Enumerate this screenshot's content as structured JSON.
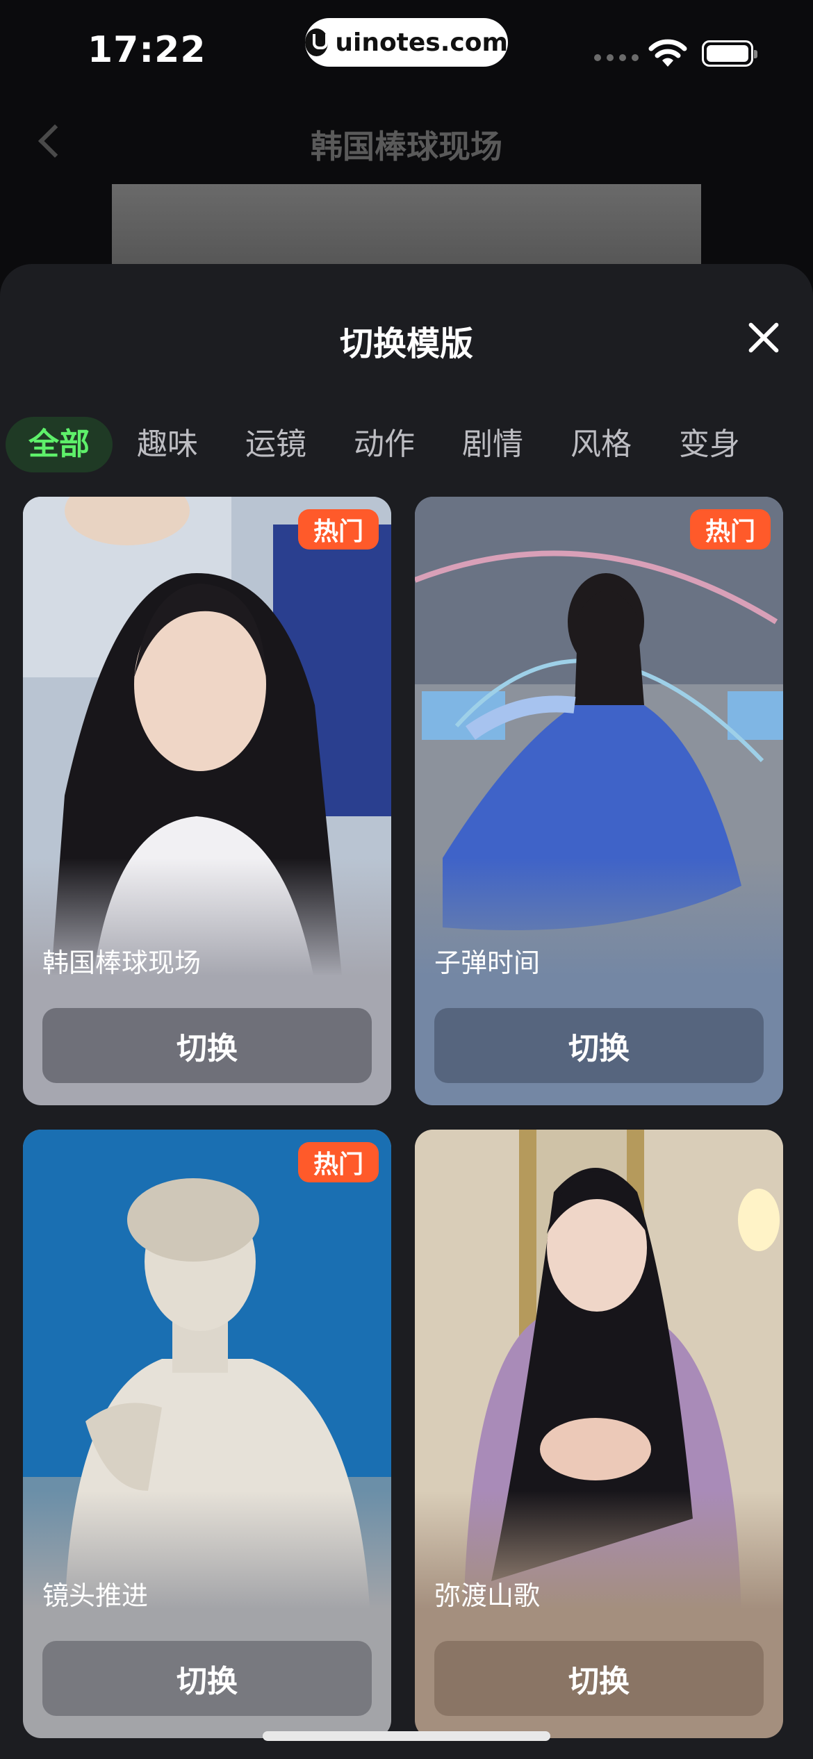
{
  "status_bar": {
    "time": "17:22",
    "url": "uinotes.com"
  },
  "header": {
    "title": "韩国棒球现场"
  },
  "sheet": {
    "title": "切换模版"
  },
  "tabs": [
    {
      "label": "全部",
      "active": true
    },
    {
      "label": "趣味",
      "active": false
    },
    {
      "label": "运镜",
      "active": false
    },
    {
      "label": "动作",
      "active": false
    },
    {
      "label": "剧情",
      "active": false
    },
    {
      "label": "风格",
      "active": false
    },
    {
      "label": "变身",
      "active": false
    }
  ],
  "templates": [
    {
      "name": "韩国棒球现场",
      "badge": "热门",
      "button": "切换"
    },
    {
      "name": "子弹时间",
      "badge": "热门",
      "button": "切换"
    },
    {
      "name": "镜头推进",
      "badge": "热门",
      "button": "切换"
    },
    {
      "name": "弥渡山歌",
      "badge": "",
      "button": "切换"
    }
  ],
  "colors": {
    "accent_green": "#5ef06a",
    "hot_badge": "#ff5a2a",
    "sheet_bg": "#1c1d21"
  }
}
